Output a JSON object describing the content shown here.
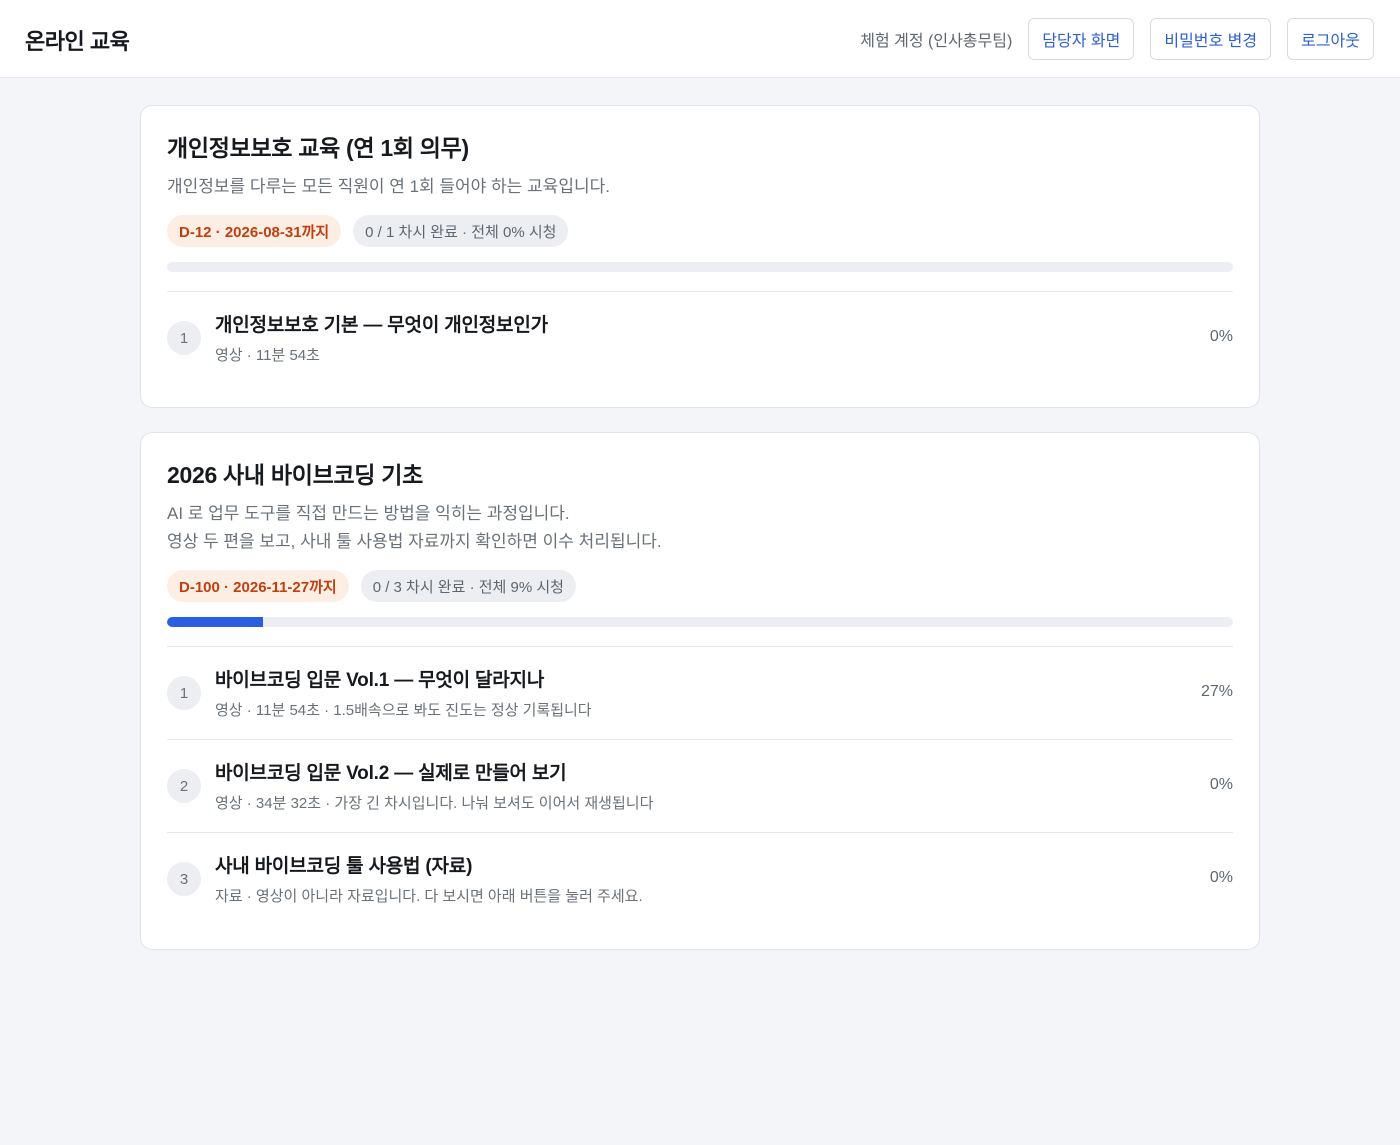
{
  "header": {
    "app_title": "온라인 교육",
    "account_label": "체험 계정 (인사총무팀)",
    "buttons": {
      "admin": "담당자 화면",
      "change_password": "비밀번호 변경",
      "logout": "로그아웃"
    }
  },
  "courses": [
    {
      "title": "개인정보보호 교육 (연 1회 의무)",
      "description": "개인정보를 다루는 모든 직원이 연 1회 들어야 하는 교육입니다.",
      "deadline_badge": "D-12 · 2026-08-31까지",
      "progress_badge": "0 / 1 차시 완료 · 전체 0% 시청",
      "progress_percent": 0,
      "lessons": [
        {
          "number": "1",
          "title": "개인정보보호 기본 — 무엇이 개인정보인가",
          "meta": "영상 · 11분 54초",
          "percent": "0%"
        }
      ]
    },
    {
      "title": "2026 사내 바이브코딩 기초",
      "description": "AI 로 업무 도구를 직접 만드는 방법을 익히는 과정입니다.\n영상 두 편을 보고, 사내 툴 사용법 자료까지 확인하면 이수 처리됩니다.",
      "deadline_badge": "D-100 · 2026-11-27까지",
      "progress_badge": "0 / 3 차시 완료 · 전체 9% 시청",
      "progress_percent": 9,
      "lessons": [
        {
          "number": "1",
          "title": "바이브코딩 입문 Vol.1 — 무엇이 달라지나",
          "meta": "영상 · 11분 54초 · 1.5배속으로 봐도 진도는 정상 기록됩니다",
          "percent": "27%"
        },
        {
          "number": "2",
          "title": "바이브코딩 입문 Vol.2 — 실제로 만들어 보기",
          "meta": "영상 · 34분 32초 · 가장 긴 차시입니다. 나눠 보셔도 이어서 재생됩니다",
          "percent": "0%"
        },
        {
          "number": "3",
          "title": "사내 바이브코딩 툴 사용법 (자료)",
          "meta": "자료 · 영상이 아니라 자료입니다. 다 보시면 아래 버튼을 눌러 주세요.",
          "percent": "0%"
        }
      ]
    }
  ]
}
